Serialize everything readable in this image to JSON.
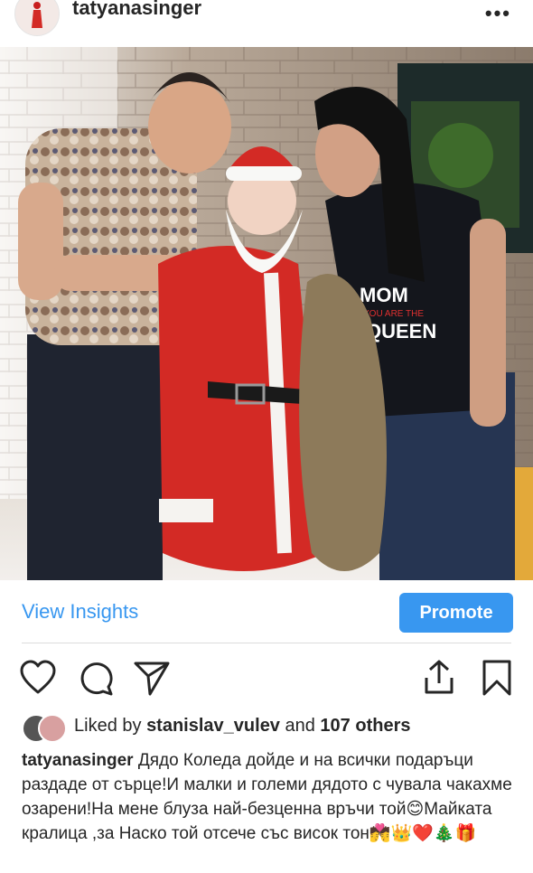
{
  "header": {
    "username": "tatyanasinger",
    "more_label": "•••"
  },
  "post": {
    "view_insights_label": "View Insights",
    "promote_label": "Promote"
  },
  "photo": {
    "shirt_text_line1": "MOM",
    "shirt_text_line2": "YOU ARE THE",
    "shirt_text_line3": "QUEEN"
  },
  "likes": {
    "prefix": "Liked by ",
    "user": "stanislav_vulev",
    "middle": " and ",
    "others": "107 others"
  },
  "caption": {
    "username": "tatyanasinger",
    "text": "Дядо Коледа дойде и на всички подаръци раздаде от сърце!И малки и големи дядото с чувала чакахме озарени!На мене блуза най-безценна връчи той😊Майката кралица ,за Наско той отсече със висок тон💏👑❤️🎄🎁"
  },
  "colors": {
    "accent": "#3897f0",
    "text": "#262626",
    "divider": "#dbdbdb",
    "santa_red": "#d32a25"
  }
}
